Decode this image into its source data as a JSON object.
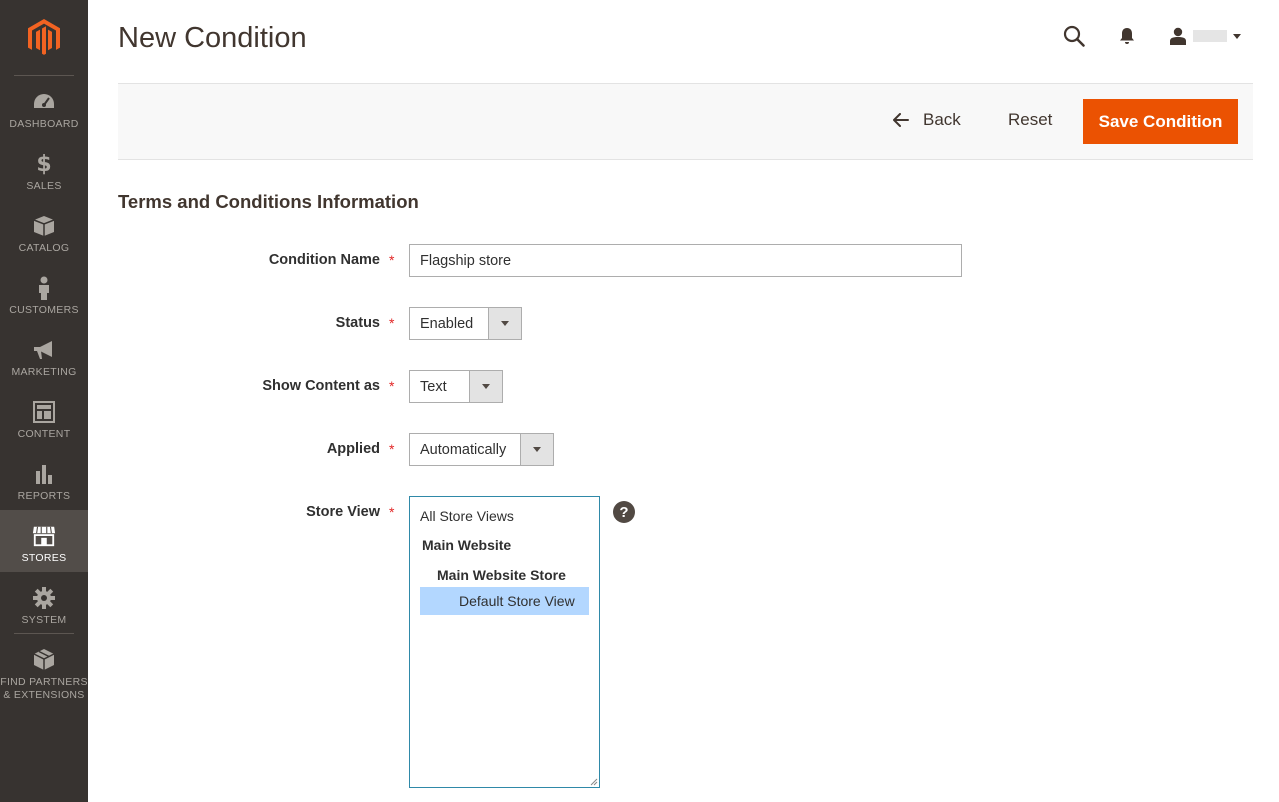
{
  "sidebar": {
    "logo": "magento-logo",
    "items": [
      {
        "label": "DASHBOARD",
        "icon": "dashboard-icon"
      },
      {
        "label": "SALES",
        "icon": "dollar-icon"
      },
      {
        "label": "CATALOG",
        "icon": "box-icon"
      },
      {
        "label": "CUSTOMERS",
        "icon": "person-icon"
      },
      {
        "label": "MARKETING",
        "icon": "megaphone-icon"
      },
      {
        "label": "CONTENT",
        "icon": "layout-icon"
      },
      {
        "label": "REPORTS",
        "icon": "bar-chart-icon"
      },
      {
        "label": "STORES",
        "icon": "storefront-icon",
        "active": true
      },
      {
        "label": "SYSTEM",
        "icon": "gear-icon"
      },
      {
        "label": "FIND PARTNERS\n& EXTENSIONS",
        "icon": "cube-icon"
      }
    ]
  },
  "header": {
    "title": "New Condition"
  },
  "actions": {
    "back_label": "Back",
    "reset_label": "Reset",
    "save_label": "Save Condition"
  },
  "form": {
    "section_title": "Terms and Conditions Information",
    "condition_name": {
      "label": "Condition Name",
      "value": "Flagship store"
    },
    "status": {
      "label": "Status",
      "value": "Enabled"
    },
    "show_content_as": {
      "label": "Show Content as",
      "value": "Text"
    },
    "applied": {
      "label": "Applied",
      "value": "Automatically"
    },
    "store_view": {
      "label": "Store View",
      "options": {
        "all": "All Store Views",
        "website": "Main Website",
        "store": "Main Website Store",
        "view": "Default Store View"
      },
      "selected": "Default Store View",
      "help": "?"
    }
  },
  "colors": {
    "sidebar_bg": "#373330",
    "accent": "#eb5202",
    "required": "#e22626",
    "selected_option": "#b3d7ff"
  }
}
